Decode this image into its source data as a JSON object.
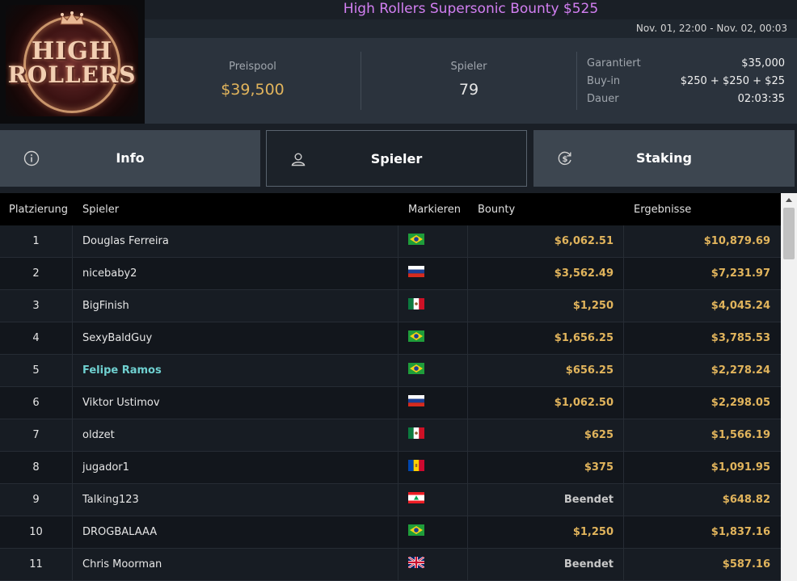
{
  "tournament": {
    "title": "High Rollers Supersonic Bounty $525",
    "dates": "Nov. 01, 22:00 - Nov. 02, 00:03",
    "logo_line1": "HIGH",
    "logo_line2": "ROLLERS"
  },
  "stats": {
    "prize_pool_label": "Preispool",
    "prize_pool_value": "$39,500",
    "players_label": "Spieler",
    "players_value": "79",
    "guaranteed_label": "Garantiert",
    "guaranteed_value": "$35,000",
    "buyin_label": "Buy-in",
    "buyin_value": "$250 + $250 + $25",
    "duration_label": "Dauer",
    "duration_value": "02:03:35"
  },
  "tabs": [
    {
      "label": "Info",
      "icon": "info-icon"
    },
    {
      "label": "Spieler",
      "icon": "user-icon",
      "active": true
    },
    {
      "label": "Staking",
      "icon": "dollar-cycle-icon"
    }
  ],
  "table": {
    "headers": [
      "Platzierung",
      "Spieler",
      "Markieren",
      "Bounty",
      "Ergebnisse"
    ],
    "rows": [
      {
        "place": "1",
        "player": "Douglas Ferreira",
        "flag": "brazil-flag-icon",
        "bounty": "$6,062.51",
        "result": "$10,879.69"
      },
      {
        "place": "2",
        "player": "nicebaby2",
        "flag": "russia-flag-icon",
        "bounty": "$3,562.49",
        "result": "$7,231.97"
      },
      {
        "place": "3",
        "player": "BigFinish",
        "flag": "mexico-flag-icon",
        "bounty": "$1,250",
        "result": "$4,045.24"
      },
      {
        "place": "4",
        "player": "SexyBaldGuy",
        "flag": "brazil-flag-icon",
        "bounty": "$1,656.25",
        "result": "$3,785.53"
      },
      {
        "place": "5",
        "player": "Felipe Ramos",
        "flag": "brazil-flag-icon",
        "bounty": "$656.25",
        "result": "$2,278.24",
        "highlight": true
      },
      {
        "place": "6",
        "player": "Viktor Ustimov",
        "flag": "russia-flag-icon",
        "bounty": "$1,062.50",
        "result": "$2,298.05"
      },
      {
        "place": "7",
        "player": "oldzet",
        "flag": "mexico-flag-icon",
        "bounty": "$625",
        "result": "$1,566.19"
      },
      {
        "place": "8",
        "player": "jugador1",
        "flag": "moldova-flag-icon",
        "bounty": "$375",
        "result": "$1,091.95"
      },
      {
        "place": "9",
        "player": "Talking123",
        "flag": "lebanon-flag-icon",
        "bounty": "Beendet",
        "result": "$648.82"
      },
      {
        "place": "10",
        "player": "DROGBALAAA",
        "flag": "brazil-flag-icon",
        "bounty": "$1,250",
        "result": "$1,837.16"
      },
      {
        "place": "11",
        "player": "Chris Moorman",
        "flag": "uk-flag-icon",
        "bounty": "Beendet",
        "result": "$587.16"
      }
    ]
  },
  "colors": {
    "title": "#d37ff2",
    "gold": "#e1b45c",
    "highlight_player": "#6fd0d0"
  }
}
